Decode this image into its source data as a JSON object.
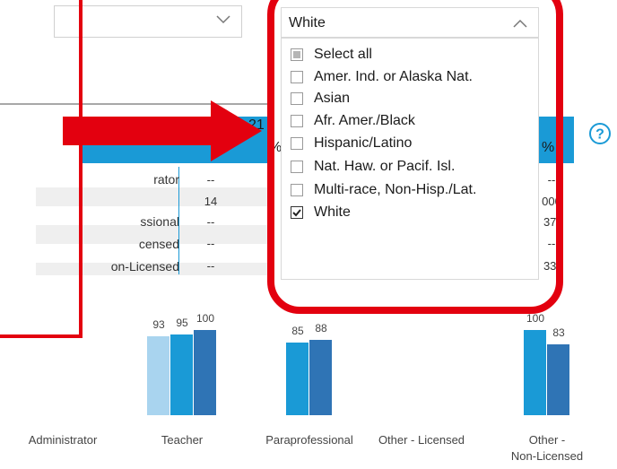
{
  "colors": {
    "accent": "#1a9ad6",
    "highlight_red": "#e3000f",
    "bar_light": "#a9d4ef",
    "bar_mid": "#1a9ad6",
    "bar_dark": "#2f74b5"
  },
  "left_dropdown": {
    "icon": "chevron-down-icon"
  },
  "table": {
    "header_digit": "21",
    "header_pct": "%",
    "header_pct_right": "%",
    "rows": [
      {
        "label": "rator",
        "value": "--",
        "right": "--"
      },
      {
        "label": "",
        "value": "14",
        "right": "000"
      },
      {
        "label": "ssional",
        "value": "--",
        "right": "37."
      },
      {
        "label": "censed",
        "value": "--",
        "right": "--"
      },
      {
        "label": "on-Licensed",
        "value": "--",
        "right": "33."
      }
    ]
  },
  "help_icon": {
    "glyph": "?"
  },
  "race_filter": {
    "selected": "White",
    "options": [
      {
        "label": "Select all",
        "state": "partial"
      },
      {
        "label": "Amer. Ind. or Alaska Nat.",
        "state": "unchecked"
      },
      {
        "label": "Asian",
        "state": "unchecked"
      },
      {
        "label": "Afr. Amer./Black",
        "state": "unchecked"
      },
      {
        "label": "Hispanic/Latino",
        "state": "unchecked"
      },
      {
        "label": "Nat. Haw. or Pacif. Isl.",
        "state": "unchecked"
      },
      {
        "label": "Multi-race, Non-Hisp./Lat.",
        "state": "unchecked"
      },
      {
        "label": "White",
        "state": "checked"
      }
    ]
  },
  "chart_data": {
    "type": "bar",
    "categories": [
      "Administrator",
      "Teacher",
      "Paraprofessional",
      "Other - Licensed",
      "Other - Non-Licensed"
    ],
    "series": [
      {
        "values": [
          null,
          93,
          null,
          null,
          null
        ]
      },
      {
        "values": [
          null,
          95,
          85,
          null,
          100
        ]
      },
      {
        "values": [
          null,
          100,
          88,
          null,
          83
        ]
      }
    ]
  }
}
